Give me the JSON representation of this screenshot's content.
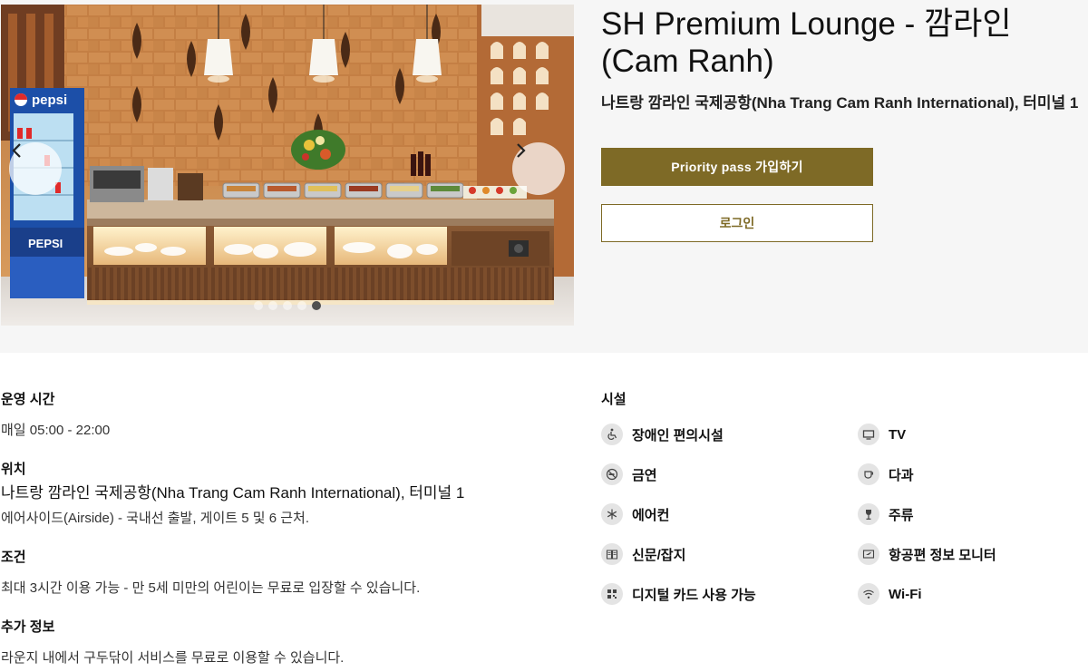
{
  "lounge": {
    "title": "SH Premium Lounge - 깜라인 (Cam Ranh)",
    "subtitle": "나트랑 깜라인 국제공항(Nha Trang Cam Ranh International), 터미널 1"
  },
  "actions": {
    "join_label": "Priority pass 가입하기",
    "login_label": "로그인"
  },
  "carousel": {
    "image_brand_text": [
      "pepsi",
      "PEPSI"
    ],
    "slide_count": 5,
    "active_slide": 4
  },
  "details": {
    "hours": {
      "heading": "운영 시간",
      "value": "매일 05:00 - 22:00"
    },
    "location": {
      "heading": "위치",
      "airport": "나트랑 깜라인 국제공항(Nha Trang Cam Ranh International), 터미널 1",
      "directions": "에어사이드(Airside) - 국내선 출발, 게이트 5 및 6 근처."
    },
    "conditions": {
      "heading": "조건",
      "value": "최대 3시간 이용 가능 - 만 5세 미만의 어린이는 무료로 입장할 수 있습니다."
    },
    "additional": {
      "heading": "추가 정보",
      "value": "라운지 내에서 구두닦이 서비스를 무료로 이용할 수 있습니다."
    }
  },
  "facilities": {
    "heading": "시설",
    "items": [
      {
        "label": "장애인 편의시설",
        "icon": "wheelchair-icon"
      },
      {
        "label": "TV",
        "icon": "tv-icon"
      },
      {
        "label": "금연",
        "icon": "no-smoking-icon"
      },
      {
        "label": "다과",
        "icon": "cup-icon"
      },
      {
        "label": "에어컨",
        "icon": "snowflake-icon"
      },
      {
        "label": "주류",
        "icon": "wine-glass-icon"
      },
      {
        "label": "신문/잡지",
        "icon": "newspaper-icon"
      },
      {
        "label": "항공편 정보 모니터",
        "icon": "flight-monitor-icon"
      },
      {
        "label": "디지털 카드 사용 가능",
        "icon": "qr-code-icon"
      },
      {
        "label": "Wi-Fi",
        "icon": "wifi-icon"
      }
    ]
  },
  "colors": {
    "accent": "#7e6a26",
    "band": "#f6f6f6",
    "icon_bg": "#e4e4e4"
  }
}
